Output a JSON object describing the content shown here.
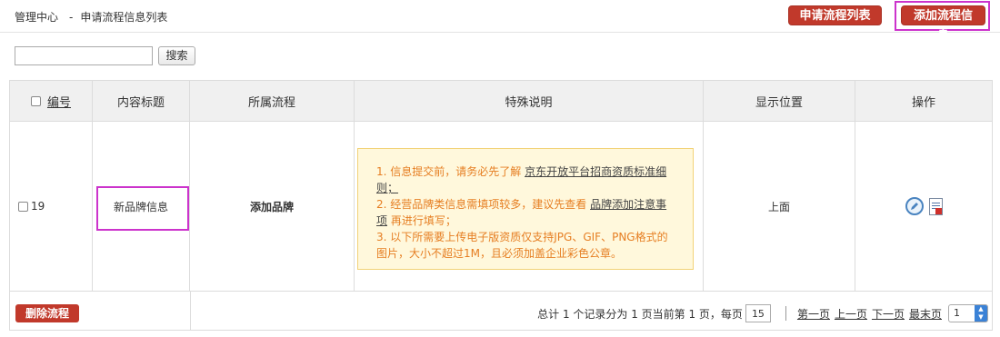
{
  "header": {
    "breadcrumb_root": "管理中心",
    "breadcrumb_sep": "-",
    "breadcrumb_current": "申请流程信息列表",
    "list_button": "申请流程列表",
    "add_button": "添加流程信息"
  },
  "search": {
    "input_value": "",
    "button_label": "搜索"
  },
  "table": {
    "columns": [
      "编号",
      "内容标题",
      "所属流程",
      "特殊说明",
      "显示位置",
      "操作"
    ],
    "rows": [
      {
        "id": "19",
        "title": "新品牌信息",
        "flow": "添加品牌",
        "notes": {
          "line1_prefix": "1. 信息提交前，请务必先了解 ",
          "line1_link": "京东开放平台招商资质标准细则；",
          "line2_prefix": "2. 经营品牌类信息需填项较多，建议先查看 ",
          "line2_link": "品牌添加注意事项",
          "line2_suffix": " 再进行填写；",
          "line3": "3. 以下所需要上传电子版资质仅支持JPG、GIF、PNG格式的图片，大小不超过1M，且必须加盖企业彩色公章。"
        },
        "position": "上面",
        "actions": [
          "edit-icon",
          "document-icon"
        ]
      }
    ]
  },
  "footer": {
    "delete_button": "删除流程",
    "summary": "总计 1 个记录分为 1 页当前第 1 页，每页",
    "per_page": "15",
    "first": "第一页",
    "prev": "上一页",
    "next": "下一页",
    "last": "最末页",
    "page_select": "1"
  }
}
